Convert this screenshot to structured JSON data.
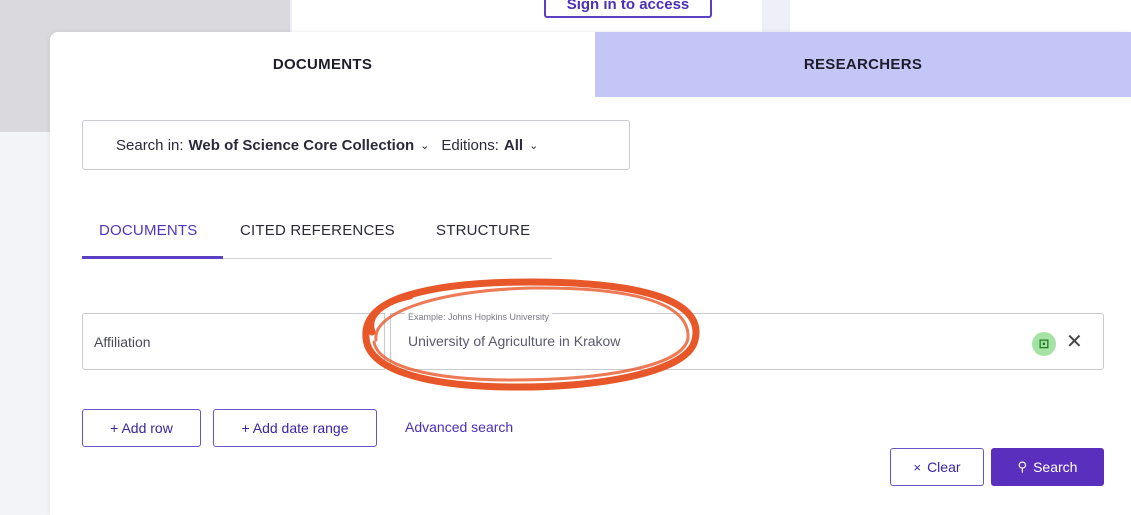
{
  "top": {
    "signin_label": "Sign in to access"
  },
  "tabs": {
    "documents": "DOCUMENTS",
    "researchers": "RESEARCHERS"
  },
  "search_in": {
    "prefix": "Search in:",
    "collection": "Web of Science Core Collection",
    "editions_prefix": "Editions:",
    "editions_value": "All"
  },
  "subtabs": [
    "DOCUMENTS",
    "CITED REFERENCES",
    "STRUCTURE"
  ],
  "query_row": {
    "field": "Affiliation",
    "example_label": "Example: Johns Hopkins University",
    "value": "University of Agriculture in Krakow"
  },
  "buttons": {
    "add_row": "+ Add row",
    "add_date_range": "+ Add date range",
    "advanced_search": "Advanced search",
    "clear": "Clear",
    "search": "Search"
  },
  "icons": {
    "tree": "tree-icon",
    "close": "close-icon",
    "chevron": "chevron-down-icon",
    "search": "search-icon"
  },
  "colors": {
    "accent": "#5b2fbe",
    "researchers_tab": "#c5c6f8",
    "annotation": "#e8572a",
    "tree_badge": "#a6e2a4"
  }
}
